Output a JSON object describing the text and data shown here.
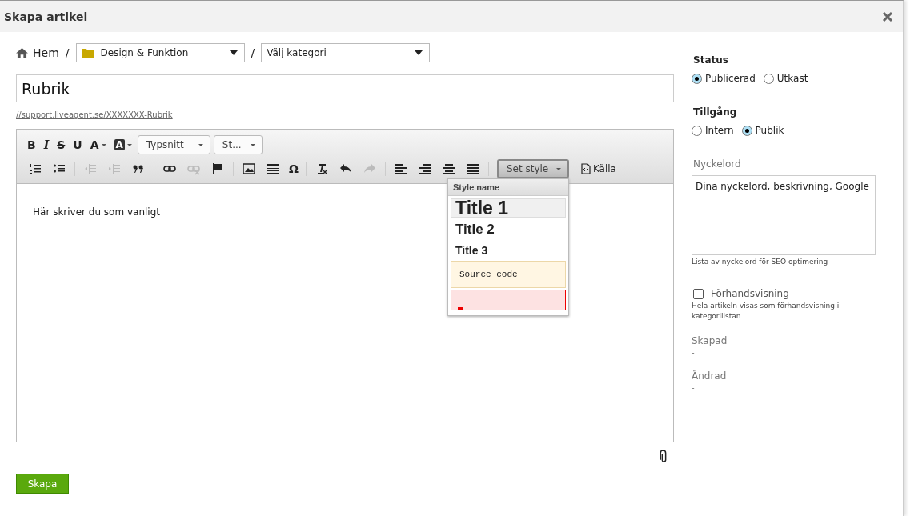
{
  "window": {
    "title": "Skapa artikel"
  },
  "breadcrumb": {
    "home": "Hem",
    "separator": "/",
    "department": "Design & Funktion",
    "category": "Välj kategori"
  },
  "title_field": {
    "value": "Rubrik"
  },
  "url": "//support.liveagent.se/XXXXXXX-Rubrik",
  "toolbar": {
    "rows": [
      [
        {
          "kind": "bold",
          "label": "B",
          "disabled": false
        },
        {
          "kind": "italic",
          "label": "I",
          "disabled": false
        },
        {
          "kind": "strike",
          "label": "S",
          "disabled": false
        },
        {
          "kind": "underline",
          "label": "U",
          "disabled": false
        },
        {
          "kind": "textcolor",
          "label": "A",
          "disabled": false
        },
        {
          "kind": "bgcolor",
          "label": "A",
          "disabled": false
        },
        {
          "kind": "font",
          "label": "Typsnitt",
          "disabled": false
        },
        {
          "kind": "size",
          "label": "St...",
          "disabled": false
        }
      ],
      [
        {
          "kind": "numlist",
          "disabled": false
        },
        {
          "kind": "bullist",
          "disabled": false
        },
        {
          "kind": "sep"
        },
        {
          "kind": "outdent",
          "disabled": true
        },
        {
          "kind": "indent",
          "disabled": true
        },
        {
          "kind": "quote",
          "disabled": false
        },
        {
          "kind": "sep"
        },
        {
          "kind": "link",
          "disabled": false
        },
        {
          "kind": "unlink",
          "disabled": true
        },
        {
          "kind": "flag",
          "disabled": false
        },
        {
          "kind": "sep"
        },
        {
          "kind": "image",
          "disabled": false
        },
        {
          "kind": "hr",
          "disabled": false
        },
        {
          "kind": "omega",
          "label": "Ω",
          "disabled": false
        },
        {
          "kind": "sep"
        },
        {
          "kind": "clearformat",
          "disabled": false
        },
        {
          "kind": "undo",
          "disabled": false
        },
        {
          "kind": "redo",
          "disabled": true
        },
        {
          "kind": "sep"
        },
        {
          "kind": "alignleft",
          "disabled": false
        },
        {
          "kind": "alignright",
          "disabled": false
        },
        {
          "kind": "aligncenter",
          "disabled": false
        },
        {
          "kind": "justify",
          "disabled": false
        },
        {
          "kind": "sep"
        },
        {
          "kind": "style",
          "label": "Set style",
          "disabled": false
        },
        {
          "kind": "source",
          "label": "Källa",
          "disabled": false
        }
      ]
    ]
  },
  "editor": {
    "text": "Här skriver du som vanligt"
  },
  "style_menu": {
    "header": "Style name",
    "items": [
      {
        "kind": "h1",
        "label": "Title 1",
        "selected": true
      },
      {
        "kind": "h2",
        "label": "Title 2",
        "selected": false
      },
      {
        "kind": "h3",
        "label": "Title 3",
        "selected": false
      },
      {
        "kind": "code",
        "label": "Source code",
        "selected": false
      },
      {
        "kind": "marker",
        "selected": false
      }
    ]
  },
  "submit": "Skapa",
  "sidebar": {
    "status": {
      "label": "Status",
      "options": [
        {
          "label": "Publicerad",
          "selected": true
        },
        {
          "label": "Utkast",
          "selected": false
        }
      ]
    },
    "access": {
      "label": "Tillgång",
      "options": [
        {
          "label": "Intern",
          "selected": false
        },
        {
          "label": "Publik",
          "selected": true
        }
      ]
    },
    "keywords": {
      "label": "Nyckelord",
      "value": "Dina nyckelord, beskrivning, Google",
      "hint": "Lista av nyckelord för SEO optimering"
    },
    "preview": {
      "label": "Förhandsvisning",
      "checked": false,
      "hint": "Hela artikeln visas som förhandsvisning i kategorilistan."
    },
    "created": {
      "label": "Skapad",
      "value": "-"
    },
    "changed": {
      "label": "Ändrad",
      "value": "-"
    }
  }
}
